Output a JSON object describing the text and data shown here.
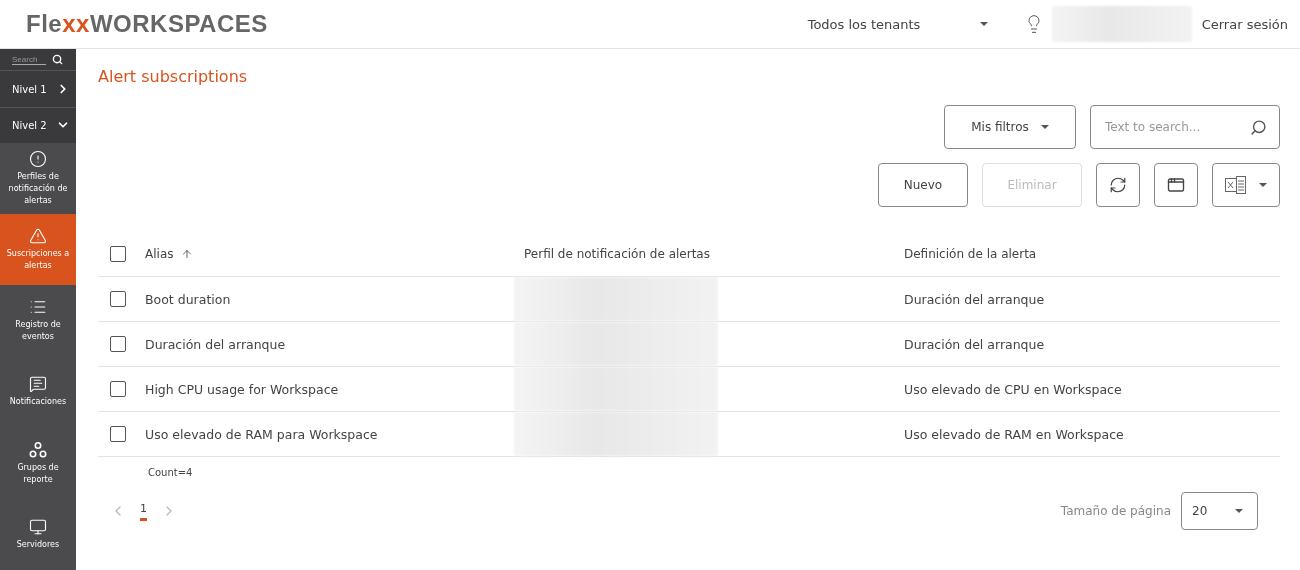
{
  "header": {
    "logo": {
      "lead": "Fle",
      "accent": "xx",
      "tail": "WORKSPACES"
    },
    "tenant_select": "Todos los tenants",
    "logout": "Cerrar sesión"
  },
  "sidebar": {
    "search": {
      "placeholder": "Search"
    },
    "levels": [
      {
        "label": "Nivel 1",
        "expanded": false
      },
      {
        "label": "Nivel 2",
        "expanded": true
      }
    ],
    "items": [
      {
        "label": "Perfiles de notificación de alertas",
        "selected": false
      },
      {
        "label": "Suscripciones a alertas",
        "selected": true
      },
      {
        "label": "Registro de eventos",
        "selected": false
      },
      {
        "label": "Notificaciones",
        "selected": false
      },
      {
        "label": "Grupos de reporte",
        "selected": false
      },
      {
        "label": "Servidores",
        "selected": false
      }
    ]
  },
  "page": {
    "title": "Alert subscriptions"
  },
  "toolbar": {
    "filter_select": "Mis filtros",
    "search": {
      "placeholder": "Text to search..."
    },
    "buttons": [
      {
        "label": "Nuevo",
        "disabled": false
      },
      {
        "label": "Eliminar",
        "disabled": true
      }
    ]
  },
  "table": {
    "select_all_checked": false,
    "columns": [
      {
        "label": "Alias",
        "sorted": true
      },
      {
        "label": "Perfil de notificación de alertas",
        "sorted": false
      },
      {
        "label": "Definición de la alerta",
        "sorted": false
      }
    ],
    "rows": [
      {
        "checked": false,
        "alias": "Boot duration",
        "definition": "Duración del arranque"
      },
      {
        "checked": false,
        "alias": "Duración del arranque",
        "definition": "Duración del arranque"
      },
      {
        "checked": false,
        "alias": "High CPU usage for Workspace",
        "definition": "Uso elevado de CPU en Workspace"
      },
      {
        "checked": false,
        "alias": "Uso elevado de RAM para Workspace",
        "definition": "Uso elevado de RAM en Workspace"
      }
    ],
    "count": "Count=4"
  },
  "pagination": {
    "pages": [
      {
        "label": "1",
        "selected": true
      }
    ],
    "page_size_label": "Tamaño de página",
    "page_size": "20"
  }
}
